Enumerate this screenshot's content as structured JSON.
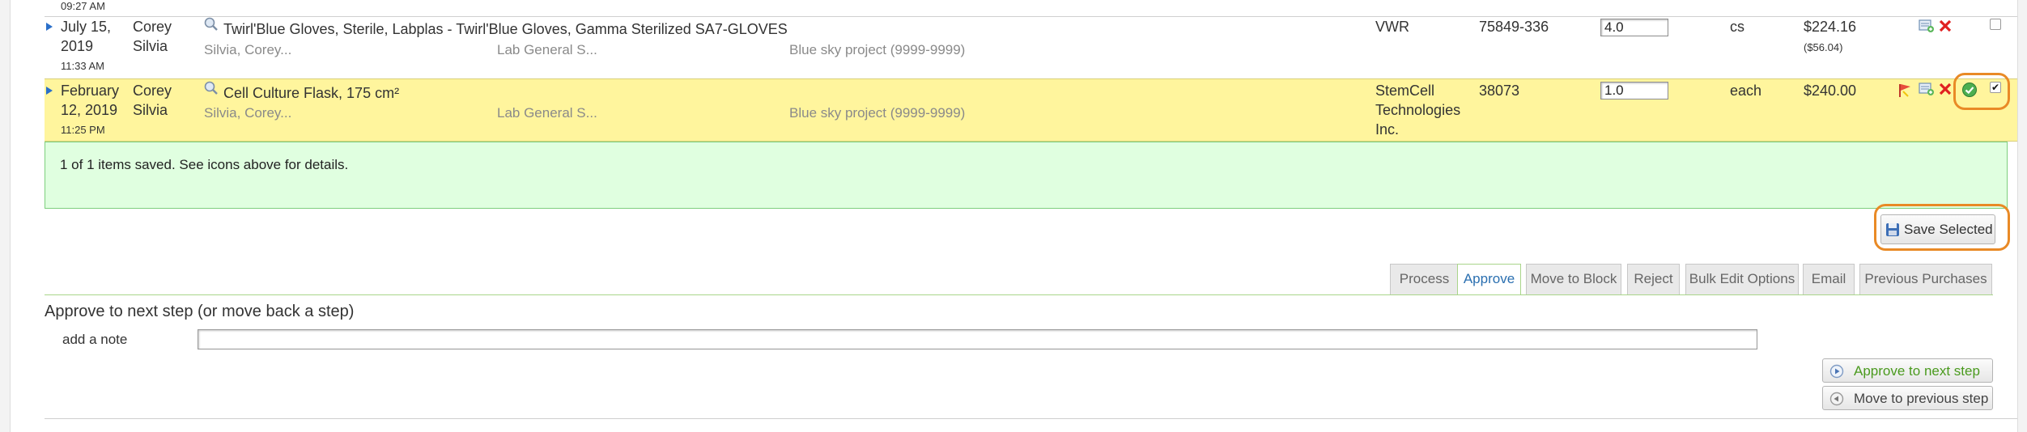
{
  "prev_row": {
    "time": "09:27 AM"
  },
  "rows": [
    {
      "date": "July 15,\n2019",
      "date_line1": "July 15,",
      "date_line2": "2019",
      "time": "11:33 AM",
      "requester_line1": "Corey",
      "requester_line2": "Silvia",
      "item": "Twirl'Blue Gloves, Sterile, Labplas - Twirl'Blue Gloves, Gamma Sterilized SA7-GLOVES",
      "sub_requester": "Silvia, Corey...",
      "sub_account": "Lab General S...",
      "sub_project": "Blue sky project (9999-9999)",
      "vendor_lines": [
        "VWR"
      ],
      "catalog": "75849-336",
      "quantity": "4.0",
      "unit": "cs",
      "price": "$224.16",
      "unit_price": "($56.04)",
      "checked": false
    },
    {
      "date_line1": "February",
      "date_line2": "12, 2019",
      "time": "11:25 PM",
      "requester_line1": "Corey",
      "requester_line2": "Silvia",
      "item": "Cell Culture Flask, 175 cm²",
      "sub_requester": "Silvia, Corey...",
      "sub_account": "Lab General S...",
      "sub_project": "Blue sky project (9999-9999)",
      "vendor_lines": [
        "StemCell",
        "Technologies",
        "Inc."
      ],
      "catalog": "38073",
      "quantity": "1.0",
      "unit": "each",
      "price": "$240.00",
      "checked": true
    }
  ],
  "status_message": "1 of 1 items saved. See icons above for details.",
  "save_selected_label": "Save Selected",
  "tabs": [
    {
      "label": "Process",
      "active": false
    },
    {
      "label": "Approve",
      "active": true
    },
    {
      "label": "Move to Block",
      "active": false
    },
    {
      "label": "Reject",
      "active": false
    },
    {
      "label": "Bulk Edit Options",
      "active": false
    },
    {
      "label": "Email",
      "active": false
    },
    {
      "label": "Previous Purchases",
      "active": false
    }
  ],
  "approve_section": {
    "heading": "Approve to next step (or move back a step)",
    "note_label": "add a note",
    "note_value": "",
    "approve_button": "Approve to next step",
    "move_back_button": "Move to previous step"
  },
  "colors": {
    "highlight_row": "#fff59d",
    "success_box": "#e0ffe0",
    "callout_ring": "#e98a26",
    "link_blue": "#2a6fb0",
    "approve_green": "#4a9a1e"
  },
  "icons": [
    "search-icon",
    "add-to-cart-icon",
    "delete-icon",
    "flag-icon",
    "saved-ok-icon",
    "save-disk-icon",
    "play-circle-icon",
    "back-circle-icon"
  ]
}
